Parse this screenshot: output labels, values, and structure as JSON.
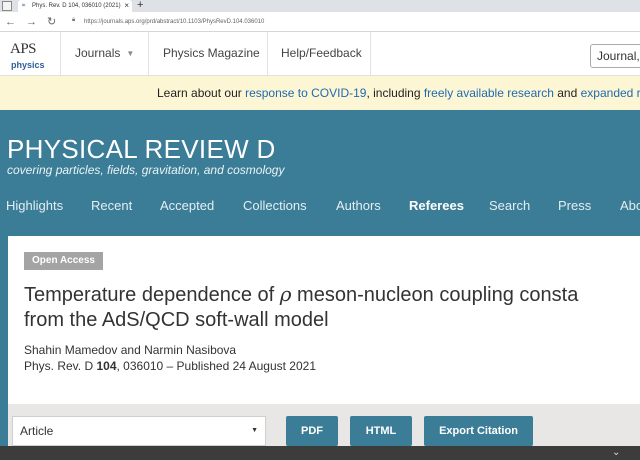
{
  "browser": {
    "tab_title": "Phys. Rev. D 104, 036010 (2021)",
    "tab_close": "×",
    "new_tab": "+",
    "url": "https://journals.aps.org/prd/abstract/10.1103/PhysRevD.104.036010",
    "back_glyph": "←",
    "forward_glyph": "→",
    "reload_glyph": "↻"
  },
  "header": {
    "logo_top": "APS",
    "logo_bottom": "physics",
    "nav": [
      {
        "label": "Journals"
      },
      {
        "label": "Physics Magazine"
      },
      {
        "label": "Help/Feedback"
      }
    ],
    "search_value": "Journal, vol"
  },
  "notice": {
    "prefix": "Learn about our ",
    "link1": "response to COVID-19",
    "middle": ", including ",
    "link2": "freely available research",
    "and": " and ",
    "link3": "expanded re"
  },
  "journal": {
    "title": "PHYSICAL REVIEW D",
    "subtitle": "covering particles, fields, gravitation, and cosmology",
    "nav": [
      {
        "label": "Highlights"
      },
      {
        "label": "Recent"
      },
      {
        "label": "Accepted"
      },
      {
        "label": "Collections"
      },
      {
        "label": "Authors"
      },
      {
        "label": "Referees"
      },
      {
        "label": "Search"
      },
      {
        "label": "Press"
      },
      {
        "label": "Abo"
      }
    ]
  },
  "article": {
    "badge": "Open Access",
    "title_part1": "Temperature dependence of ",
    "title_rho": "ρ",
    "title_part2": " meson-nucleon coupling consta",
    "title_line2": "from the AdS/QCD soft-wall model",
    "authors": "Shahin Mamedov and Narmin Nasibova",
    "journal_ref": "Phys. Rev. D ",
    "volume": "104",
    "rest": ", 036010 – Published 24 August 2021"
  },
  "toolbar": {
    "select_value": "Article",
    "buttons": [
      {
        "label": "PDF"
      },
      {
        "label": "HTML"
      },
      {
        "label": "Export Citation"
      }
    ]
  },
  "colors": {
    "brand": "#3b7d96",
    "notice_bg": "#fdf6d4",
    "link": "#1f6ab0"
  }
}
